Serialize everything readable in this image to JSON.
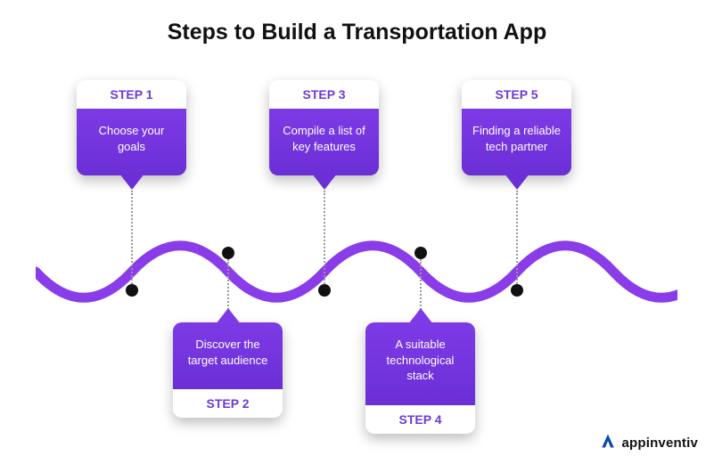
{
  "title": "Steps to Build a Transportation App",
  "steps": [
    {
      "label": "STEP 1",
      "desc": "Choose your goals"
    },
    {
      "label": "STEP 2",
      "desc": "Discover the target audience"
    },
    {
      "label": "STEP 3",
      "desc": "Compile a list of key features"
    },
    {
      "label": "STEP 4",
      "desc": "A suitable technological stack"
    },
    {
      "label": "STEP 5",
      "desc": "Finding a reliable tech partner"
    }
  ],
  "brand": {
    "name": "appinventiv"
  },
  "colors": {
    "accent": "#6e3ad6",
    "card_gradient_top": "#7d3ae6",
    "card_gradient_bottom": "#6b2fd6"
  }
}
